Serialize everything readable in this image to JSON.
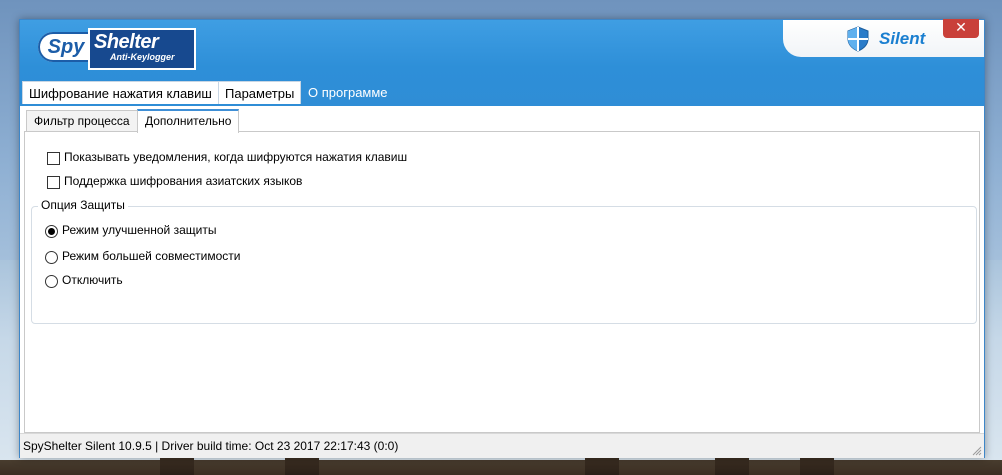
{
  "app": {
    "logo_spy": "Spy",
    "logo_shelter": "Shelter",
    "logo_sub": "Anti-Keylogger",
    "mode": "Silent",
    "close_icon": "close-icon"
  },
  "colors": {
    "titlebar": "#2e8fd8",
    "mode_text": "#1a7fd0",
    "close": "#c9403a"
  },
  "main_tabs": [
    {
      "label": "Шифрование нажатия клавиш"
    },
    {
      "label": "Параметры"
    },
    {
      "label": "О программе"
    }
  ],
  "sub_tabs": [
    {
      "label": "Фильтр процесса"
    },
    {
      "label": "Дополнительно"
    }
  ],
  "options": {
    "notify": {
      "label": "Показывать уведомления, когда шифруются нажатия клавиш",
      "checked": false
    },
    "asian": {
      "label": "Поддержка шифрования азиатских языков",
      "checked": false
    }
  },
  "protection": {
    "title": "Опция Защиты",
    "items": [
      {
        "label": "Режим улучшенной защиты",
        "selected": true
      },
      {
        "label": "Режим большей совместимости",
        "selected": false
      },
      {
        "label": "Отключить",
        "selected": false
      }
    ]
  },
  "status": {
    "text": "SpyShelter Silent 10.9.5  |  Driver build time: Oct 23 2017 22:17:43  (0:0)"
  }
}
